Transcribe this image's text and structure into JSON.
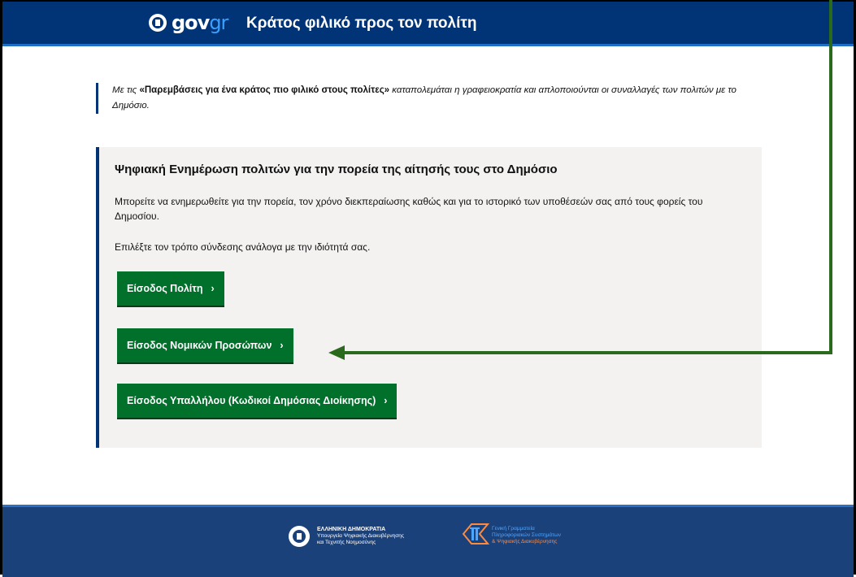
{
  "header": {
    "brand_main": "gov",
    "brand_accent": "gr",
    "tagline": "Κράτος φιλικό προς τον πολίτη"
  },
  "intro": {
    "prefix": "Με τις ",
    "bold": "«Παρεμβάσεις για ένα κράτος πιο φιλικό στους πολίτες»",
    "suffix": " καταπολεμάται η γραφειοκρατία και απλοποιούνται οι συναλλαγές των πολιτών με το Δημόσιο."
  },
  "panel": {
    "title": "Ψηφιακή Ενημέρωση πολιτών για την πορεία της αίτησής τους στο Δημόσιο",
    "description": "Μπορείτε να ενημερωθείτε για την πορεία, τον χρόνο διεκπεραίωσης καθώς και για το ιστορικό των υποθέσεών σας από τους φορείς του Δημοσίου.",
    "choose": "Επιλέξτε τον τρόπο σύνδεσης ανάλογα με την ιδιότητά σας.",
    "buttons": {
      "citizen": "Είσοδος Πολίτη",
      "legal": "Είσοδος Νομικών Προσώπων",
      "employee": "Είσοδος Υπαλλήλου (Κωδικοί Δημόσιας Διοίκησης)"
    },
    "chevron": "›"
  },
  "footer": {
    "ministry_title": "ΕΛΛΗΝΙΚΗ ΔΗΜΟΚΡΑΤΙΑ",
    "ministry_line1": "Υπουργεία Ψηφιακής Διακυβέρνησης",
    "ministry_line2": "και Τεχνιτής Νοημοσύνης",
    "gsis_line1": "Γενική Γραμματεία",
    "gsis_line2": "Πληροφοριακών Συστημάτων",
    "gsis_line3": "& Ψηφιακής Διακυβέρνησης"
  },
  "colors": {
    "header_bg": "#003476",
    "button_green": "#00702b",
    "panel_bg": "#f3f2f1",
    "annotation_arrow": "#2a6a1c"
  },
  "icons": {
    "header_logo": "greek-emblem-icon",
    "footer_logo": "greek-emblem-icon",
    "footer_gsis": "gsis-logo-icon",
    "annotation": "arrow-pointer-icon"
  }
}
